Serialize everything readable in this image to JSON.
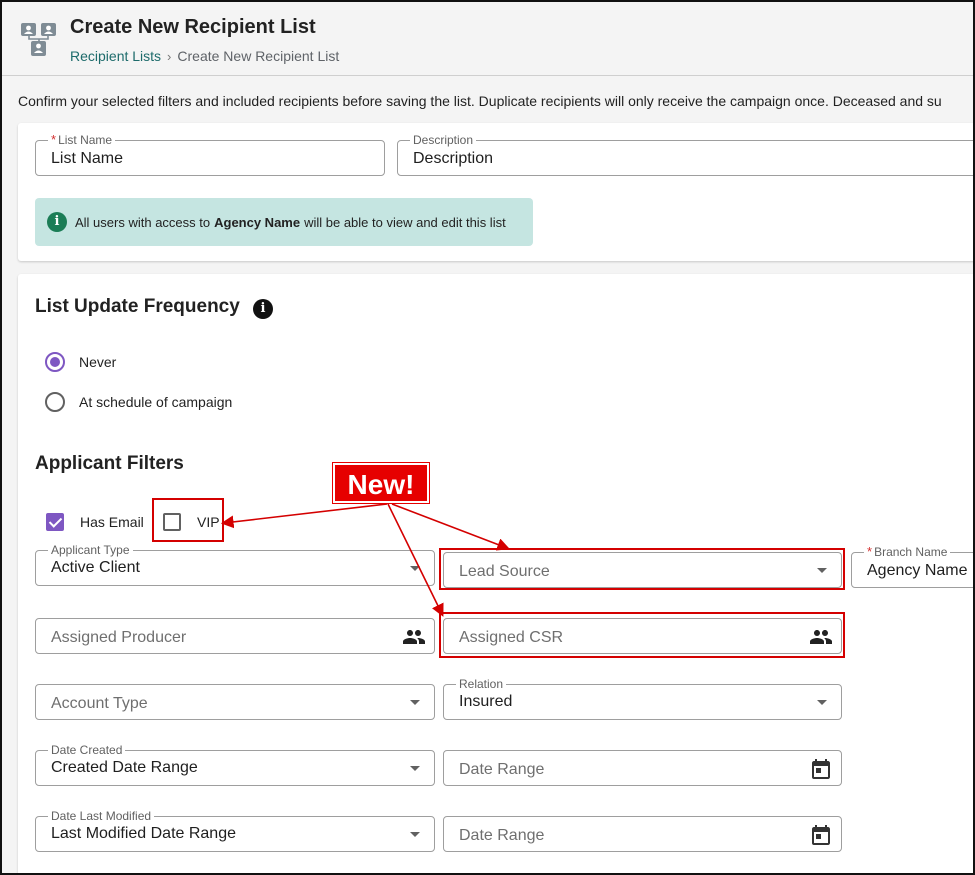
{
  "header": {
    "title": "Create New Recipient List",
    "breadcrumb": {
      "link": "Recipient Lists",
      "separator": "›",
      "current": "Create New Recipient List"
    }
  },
  "intro_text": "Confirm your selected filters and included recipients before saving the list. Duplicate recipients will only receive the campaign once. Deceased and su",
  "list_details": {
    "list_name": {
      "label": "List Name",
      "value": "List Name",
      "required": "*"
    },
    "description": {
      "label": "Description",
      "value": "Description"
    },
    "info": {
      "prefix": "All users with access to",
      "agency": "Agency Name",
      "suffix": "will be able to view and edit this list"
    }
  },
  "frequency": {
    "title": "List Update Frequency",
    "options": [
      {
        "label": "Never",
        "checked": true
      },
      {
        "label": "At schedule of campaign",
        "checked": false
      }
    ]
  },
  "applicant_filters": {
    "title": "Applicant Filters",
    "has_email": {
      "label": "Has Email",
      "checked": true
    },
    "vip": {
      "label": "VIP",
      "checked": false
    },
    "applicant_type": {
      "label": "Applicant Type",
      "value": "Active Client"
    },
    "lead_source": {
      "placeholder": "Lead Source"
    },
    "branch_name": {
      "label": "Branch Name",
      "value": "Agency Name",
      "required": "*"
    },
    "assigned_producer": {
      "placeholder": "Assigned Producer"
    },
    "assigned_csr": {
      "placeholder": "Assigned CSR"
    },
    "account_type": {
      "placeholder": "Account Type"
    },
    "relation": {
      "label": "Relation",
      "value": "Insured"
    },
    "date_created": {
      "label": "Date Created",
      "value": "Created Date Range"
    },
    "date_created_range": {
      "placeholder": "Date Range"
    },
    "date_modified": {
      "label": "Date Last Modified",
      "value": "Last Modified Date Range"
    },
    "date_modified_range": {
      "placeholder": "Date Range"
    }
  },
  "annotation": {
    "label": "New!",
    "color": "#e60000"
  },
  "colors": {
    "accent": "#7e57c2",
    "link": "#1d6b6b",
    "info_bg": "#c5e5e1"
  }
}
